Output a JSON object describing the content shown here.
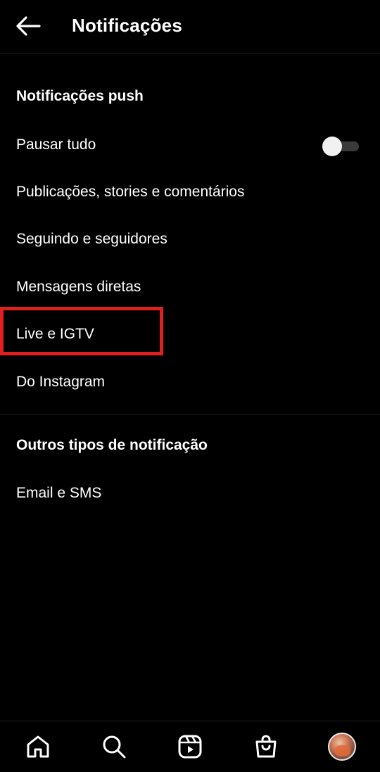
{
  "header": {
    "title": "Notificações",
    "back_icon": "arrow-left-icon"
  },
  "sections": {
    "push": {
      "title": "Notificações push",
      "items": [
        {
          "label": "Pausar tudo",
          "toggle": false
        },
        {
          "label": "Publicações, stories e comentários"
        },
        {
          "label": "Seguindo e seguidores"
        },
        {
          "label": "Mensagens diretas"
        },
        {
          "label": "Live e IGTV",
          "highlighted": true
        },
        {
          "label": "Do Instagram"
        }
      ]
    },
    "other": {
      "title": "Outros tipos de notificação",
      "items": [
        {
          "label": "Email e SMS"
        }
      ]
    }
  },
  "bottom_nav": {
    "items": [
      "home-icon",
      "search-icon",
      "reels-icon",
      "shop-icon",
      "profile-avatar"
    ]
  },
  "colors": {
    "background": "#000000",
    "text": "#ffffff",
    "highlight": "#e0201f",
    "divider": "#1e1e1e"
  }
}
